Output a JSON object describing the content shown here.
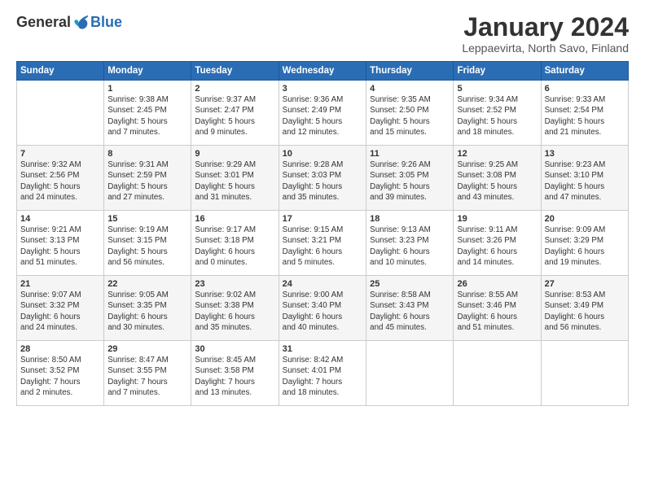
{
  "logo": {
    "general": "General",
    "blue": "Blue"
  },
  "title": "January 2024",
  "subtitle": "Leppaevirta, North Savo, Finland",
  "headers": [
    "Sunday",
    "Monday",
    "Tuesday",
    "Wednesday",
    "Thursday",
    "Friday",
    "Saturday"
  ],
  "weeks": [
    [
      {
        "day": "",
        "info": ""
      },
      {
        "day": "1",
        "info": "Sunrise: 9:38 AM\nSunset: 2:45 PM\nDaylight: 5 hours\nand 7 minutes."
      },
      {
        "day": "2",
        "info": "Sunrise: 9:37 AM\nSunset: 2:47 PM\nDaylight: 5 hours\nand 9 minutes."
      },
      {
        "day": "3",
        "info": "Sunrise: 9:36 AM\nSunset: 2:49 PM\nDaylight: 5 hours\nand 12 minutes."
      },
      {
        "day": "4",
        "info": "Sunrise: 9:35 AM\nSunset: 2:50 PM\nDaylight: 5 hours\nand 15 minutes."
      },
      {
        "day": "5",
        "info": "Sunrise: 9:34 AM\nSunset: 2:52 PM\nDaylight: 5 hours\nand 18 minutes."
      },
      {
        "day": "6",
        "info": "Sunrise: 9:33 AM\nSunset: 2:54 PM\nDaylight: 5 hours\nand 21 minutes."
      }
    ],
    [
      {
        "day": "7",
        "info": "Sunrise: 9:32 AM\nSunset: 2:56 PM\nDaylight: 5 hours\nand 24 minutes."
      },
      {
        "day": "8",
        "info": "Sunrise: 9:31 AM\nSunset: 2:59 PM\nDaylight: 5 hours\nand 27 minutes."
      },
      {
        "day": "9",
        "info": "Sunrise: 9:29 AM\nSunset: 3:01 PM\nDaylight: 5 hours\nand 31 minutes."
      },
      {
        "day": "10",
        "info": "Sunrise: 9:28 AM\nSunset: 3:03 PM\nDaylight: 5 hours\nand 35 minutes."
      },
      {
        "day": "11",
        "info": "Sunrise: 9:26 AM\nSunset: 3:05 PM\nDaylight: 5 hours\nand 39 minutes."
      },
      {
        "day": "12",
        "info": "Sunrise: 9:25 AM\nSunset: 3:08 PM\nDaylight: 5 hours\nand 43 minutes."
      },
      {
        "day": "13",
        "info": "Sunrise: 9:23 AM\nSunset: 3:10 PM\nDaylight: 5 hours\nand 47 minutes."
      }
    ],
    [
      {
        "day": "14",
        "info": "Sunrise: 9:21 AM\nSunset: 3:13 PM\nDaylight: 5 hours\nand 51 minutes."
      },
      {
        "day": "15",
        "info": "Sunrise: 9:19 AM\nSunset: 3:15 PM\nDaylight: 5 hours\nand 56 minutes."
      },
      {
        "day": "16",
        "info": "Sunrise: 9:17 AM\nSunset: 3:18 PM\nDaylight: 6 hours\nand 0 minutes."
      },
      {
        "day": "17",
        "info": "Sunrise: 9:15 AM\nSunset: 3:21 PM\nDaylight: 6 hours\nand 5 minutes."
      },
      {
        "day": "18",
        "info": "Sunrise: 9:13 AM\nSunset: 3:23 PM\nDaylight: 6 hours\nand 10 minutes."
      },
      {
        "day": "19",
        "info": "Sunrise: 9:11 AM\nSunset: 3:26 PM\nDaylight: 6 hours\nand 14 minutes."
      },
      {
        "day": "20",
        "info": "Sunrise: 9:09 AM\nSunset: 3:29 PM\nDaylight: 6 hours\nand 19 minutes."
      }
    ],
    [
      {
        "day": "21",
        "info": "Sunrise: 9:07 AM\nSunset: 3:32 PM\nDaylight: 6 hours\nand 24 minutes."
      },
      {
        "day": "22",
        "info": "Sunrise: 9:05 AM\nSunset: 3:35 PM\nDaylight: 6 hours\nand 30 minutes."
      },
      {
        "day": "23",
        "info": "Sunrise: 9:02 AM\nSunset: 3:38 PM\nDaylight: 6 hours\nand 35 minutes."
      },
      {
        "day": "24",
        "info": "Sunrise: 9:00 AM\nSunset: 3:40 PM\nDaylight: 6 hours\nand 40 minutes."
      },
      {
        "day": "25",
        "info": "Sunrise: 8:58 AM\nSunset: 3:43 PM\nDaylight: 6 hours\nand 45 minutes."
      },
      {
        "day": "26",
        "info": "Sunrise: 8:55 AM\nSunset: 3:46 PM\nDaylight: 6 hours\nand 51 minutes."
      },
      {
        "day": "27",
        "info": "Sunrise: 8:53 AM\nSunset: 3:49 PM\nDaylight: 6 hours\nand 56 minutes."
      }
    ],
    [
      {
        "day": "28",
        "info": "Sunrise: 8:50 AM\nSunset: 3:52 PM\nDaylight: 7 hours\nand 2 minutes."
      },
      {
        "day": "29",
        "info": "Sunrise: 8:47 AM\nSunset: 3:55 PM\nDaylight: 7 hours\nand 7 minutes."
      },
      {
        "day": "30",
        "info": "Sunrise: 8:45 AM\nSunset: 3:58 PM\nDaylight: 7 hours\nand 13 minutes."
      },
      {
        "day": "31",
        "info": "Sunrise: 8:42 AM\nSunset: 4:01 PM\nDaylight: 7 hours\nand 18 minutes."
      },
      {
        "day": "",
        "info": ""
      },
      {
        "day": "",
        "info": ""
      },
      {
        "day": "",
        "info": ""
      }
    ]
  ]
}
